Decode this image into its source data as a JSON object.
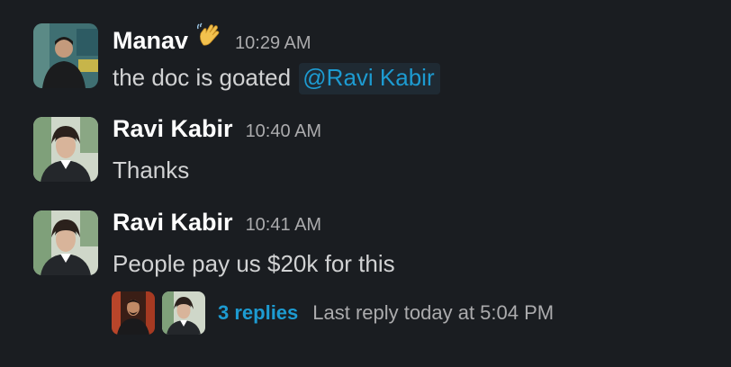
{
  "messages": [
    {
      "author": "Manav",
      "emoji": "waving-hand",
      "time": "10:29 AM",
      "text": "the doc is goated",
      "mention": "@Ravi Kabir"
    },
    {
      "author": "Ravi Kabir",
      "time": "10:40 AM",
      "text": "Thanks"
    },
    {
      "author": "Ravi Kabir",
      "time": "10:41 AM",
      "text": "People pay us $20k for this",
      "thread": {
        "replies": "3 replies",
        "last_reply": "Last reply today at 5:04 PM"
      }
    }
  ],
  "colors": {
    "background": "#1a1d21",
    "author": "#ffffff",
    "timestamp": "#ababad",
    "text": "#d1d2d3",
    "link": "#1d9bd1",
    "mention_bg": "#1f2a33"
  }
}
